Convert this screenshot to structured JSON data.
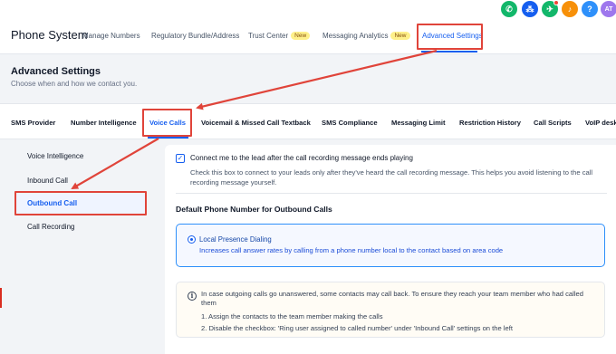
{
  "topbar": {
    "icons": [
      {
        "name": "phone-icon",
        "color": "#12b76a",
        "glyph": "✆"
      },
      {
        "name": "integrations-icon",
        "color": "#155eef",
        "glyph": "⁂"
      },
      {
        "name": "megaphone-icon",
        "color": "#12b76a",
        "glyph": "✈"
      },
      {
        "name": "bell-icon",
        "color": "#f79009",
        "glyph": "♪"
      },
      {
        "name": "help-icon",
        "color": "#2e90fa",
        "glyph": "?"
      },
      {
        "name": "avatar",
        "color": "#9e77ed",
        "glyph": "AT"
      }
    ]
  },
  "header": {
    "title": "Phone System",
    "nav": [
      {
        "label": "Manage Numbers"
      },
      {
        "label": "Regulatory Bundle/Address"
      },
      {
        "label": "Trust Center",
        "badge": "New"
      },
      {
        "label": "Messaging Analytics",
        "badge": "New"
      },
      {
        "label": "Advanced Settings",
        "active": true
      }
    ]
  },
  "page": {
    "title": "Advanced Settings",
    "subtitle": "Choose when and how we contact you."
  },
  "tabs": [
    "SMS Provider",
    "Number Intelligence",
    "Voice Calls",
    "Voicemail & Missed Call Textback",
    "SMS Compliance",
    "Messaging Limit",
    "Restriction History",
    "Call Scripts",
    "VoIP desk"
  ],
  "active_tab": "Voice Calls",
  "sidebar": {
    "items": [
      "Voice Intelligence",
      "Inbound Call",
      "Outbound Call",
      "Call Recording"
    ],
    "active": "Outbound Call"
  },
  "main": {
    "checkbox_label": "Connect me to the lead after the call recording message ends playing",
    "checkbox_checked": true,
    "checkbox_desc": "Check this box to connect to your leads only after they've heard the call recording message. This helps you avoid listening to the call recording message yourself.",
    "section_title": "Default Phone Number for Outbound Calls",
    "option": {
      "title": "Local Presence Dialing",
      "desc": "Increases call answer rates by calling from a phone number local to the contact based on area code",
      "selected": true
    },
    "info": {
      "text": "In case outgoing calls go unanswered, some contacts may call back. To ensure they reach your team member who had called them",
      "steps": [
        "1. Assign the contacts to the team member making the calls",
        "2. Disable the checkbox: 'Ring user assigned to called number' under 'Inbound Call' settings on the left"
      ]
    }
  },
  "colors": {
    "accent": "#155eef",
    "annotation": "#e0443a"
  }
}
